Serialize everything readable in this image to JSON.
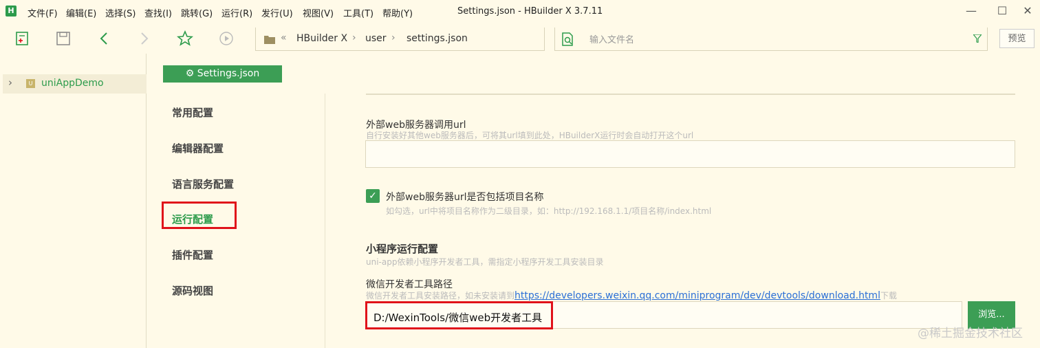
{
  "menu": {
    "items": [
      "文件(F)",
      "编辑(E)",
      "选择(S)",
      "查找(I)",
      "跳转(G)",
      "运行(R)",
      "发行(U)",
      "视图(V)",
      "工具(T)",
      "帮助(Y)"
    ],
    "logo": "H"
  },
  "window": {
    "title": "Settings.json - HBuilder X 3.7.11"
  },
  "breadcrumb": {
    "items": [
      "HBuilder X",
      "user",
      "settings.json"
    ]
  },
  "search": {
    "placeholder": "输入文件名"
  },
  "toolbar": {
    "preview_label": "预览"
  },
  "project": {
    "name": "uniAppDemo",
    "icon_text": "U"
  },
  "settings": {
    "tab_label": "Settings.json",
    "nav": [
      "常用配置",
      "编辑器配置",
      "语言服务配置",
      "运行配置",
      "插件配置",
      "源码视图"
    ],
    "active_nav": "运行配置",
    "web_url_title": "外部web服务器调用url",
    "web_url_desc": "自行安装好其他web服务器后，可将其url填到此处，HBuilderX运行时会自动打开这个url",
    "web_url_value": "",
    "include_name_label": "外部web服务器url是否包括项目名称",
    "include_name_checked": true,
    "include_name_desc": "如勾选，url中将项目名称作为二级目录，如：http://192.168.1.1/项目名称/index.html",
    "mini_title": "小程序运行配置",
    "mini_desc": "uni-app依赖小程序开发者工具，需指定小程序开发工具安装目录",
    "wx_title": "微信开发者工具路径",
    "wx_desc_prefix": "微信开发者工具安装路径，如未安装请到",
    "wx_desc_link": "https://developers.weixin.qq.com/miniprogram/dev/devtools/download.html",
    "wx_desc_suffix": "下载",
    "wx_path_value": "D:/WexinTools/微信web开发者工具",
    "browse_label": "浏览..."
  },
  "watermark": "@稀土掘金技术社区",
  "colors": {
    "accent": "#3c9e55",
    "highlight_box": "#e0121a",
    "background": "#fffae8"
  }
}
